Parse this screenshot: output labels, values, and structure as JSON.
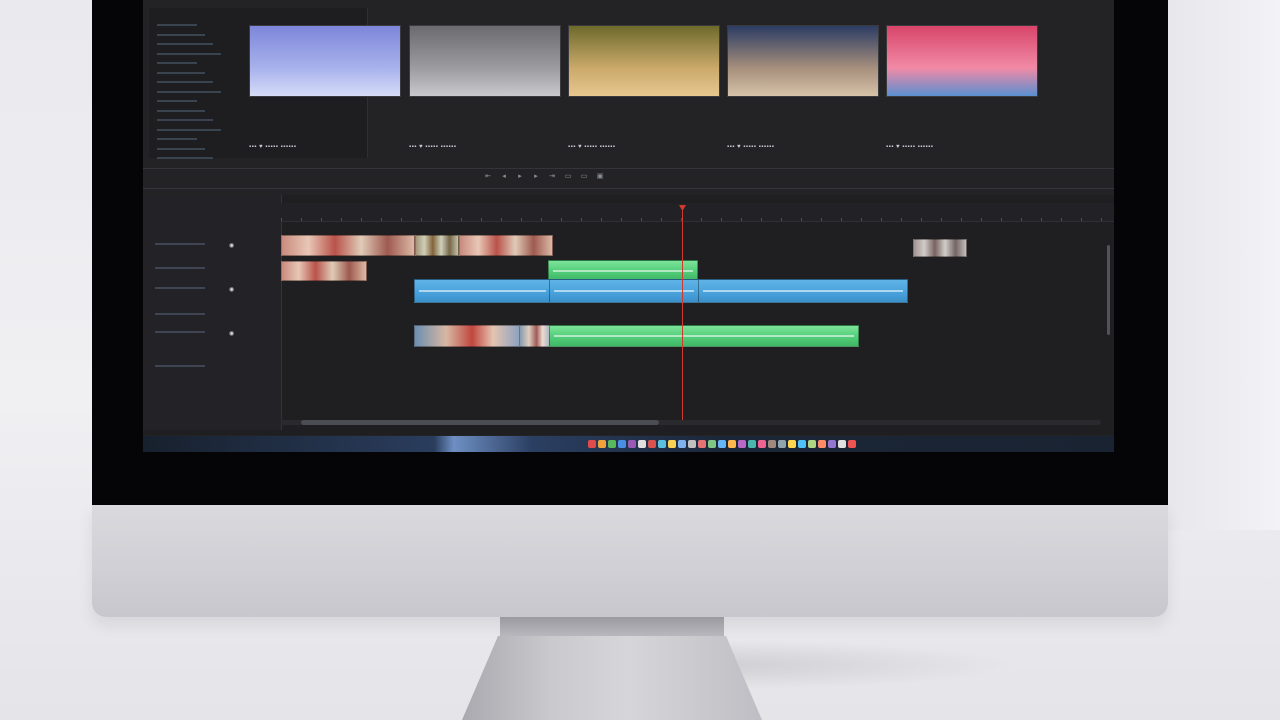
{
  "window_title": "",
  "project": {
    "sidebar_items": [
      "",
      "",
      "",
      "",
      "",
      "",
      "",
      "",
      "",
      "",
      "",
      "",
      "",
      "",
      ""
    ],
    "tiles": [
      {
        "name": "",
        "duration": "",
        "bar": "▪▪▪  ♥ ▪▪▪▪▪ ▪▪▪▪▪▪",
        "colors": [
          "#7d86d9",
          "#a7b2ec",
          "#d7dcf7"
        ]
      },
      {
        "name": "",
        "duration": "",
        "bar": "▪▪▪  ♥ ▪▪▪▪▪ ▪▪▪▪▪▪",
        "colors": [
          "#6b6b6f",
          "#9c9ca0",
          "#c9c9cc"
        ]
      },
      {
        "name": "",
        "duration": "",
        "bar": "▪▪▪  ♥ ▪▪▪▪▪ ▪▪▪▪▪▪",
        "colors": [
          "#6d6a2c",
          "#caa96a",
          "#e7c78f"
        ]
      },
      {
        "name": "",
        "duration": "",
        "bar": "▪▪▪  ♥ ▪▪▪▪▪ ▪▪▪▪▪▪",
        "colors": [
          "#2c3c63",
          "#a68f7c",
          "#d6c2a8"
        ]
      },
      {
        "name": "",
        "duration": "",
        "bar": "▪▪▪  ♥ ▪▪▪▪▪ ▪▪▪▪▪▪",
        "colors": [
          "#d8456a",
          "#f18aa6",
          "#5a8fd0"
        ]
      }
    ]
  },
  "transport": {
    "buttons": [
      {
        "name": "go-to-in-icon",
        "glyph": "⇤"
      },
      {
        "name": "step-back-icon",
        "glyph": "◂"
      },
      {
        "name": "play-icon",
        "glyph": "▸"
      },
      {
        "name": "step-forward-icon",
        "glyph": "▸"
      },
      {
        "name": "go-to-out-icon",
        "glyph": "⇥"
      },
      {
        "name": "insert-icon",
        "glyph": "▭"
      },
      {
        "name": "overwrite-icon",
        "glyph": "▭"
      },
      {
        "name": "export-frame-icon",
        "glyph": "▣"
      }
    ]
  },
  "timeline": {
    "sequence_tab": "",
    "sequence_tab_2": "",
    "right_tab": "",
    "tracks": [
      {
        "label": "",
        "toggle": "◉"
      },
      {
        "label": "",
        "toggle": ""
      },
      {
        "label": "",
        "toggle": "◉"
      },
      {
        "label": "",
        "toggle": ""
      },
      {
        "label": "",
        "toggle": "◉"
      },
      {
        "label": "",
        "toggle": ""
      }
    ],
    "timecodes": [
      "",
      "",
      "",
      "",
      "",
      "",
      "",
      ""
    ],
    "accent_colors": {
      "playhead": "#d23a2e",
      "audio_blue": "#4aa3dc",
      "audio_green": "#55cf7b"
    }
  }
}
